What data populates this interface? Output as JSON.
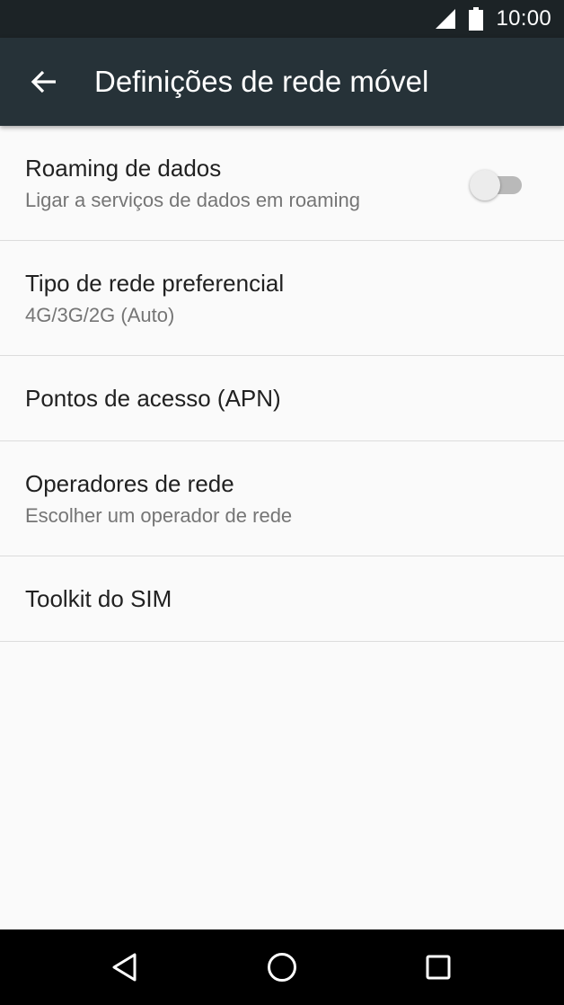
{
  "status_bar": {
    "time": "10:00",
    "signal_icon": "cellular-signal-icon",
    "battery_icon": "battery-icon"
  },
  "toolbar": {
    "back_icon": "arrow-back-icon",
    "title": "Definições de rede móvel"
  },
  "settings": {
    "items": [
      {
        "title": "Roaming de dados",
        "summary": "Ligar a serviços de dados em roaming",
        "switch_on": false
      },
      {
        "title": "Tipo de rede preferencial",
        "summary": "4G/3G/2G (Auto)"
      },
      {
        "title": "Pontos de acesso (APN)"
      },
      {
        "title": "Operadores de rede",
        "summary": "Escolher um operador de rede"
      },
      {
        "title": "Toolkit do SIM"
      }
    ]
  },
  "nav_bar": {
    "back_icon": "triangle-back-icon",
    "home_icon": "circle-home-icon",
    "recents_icon": "square-recents-icon"
  },
  "colors": {
    "status_bar": "#1c2326",
    "toolbar": "#263238",
    "background": "#fafafa",
    "divider": "#dcdcdc",
    "primary_text": "#212121",
    "secondary_text": "#757575"
  }
}
